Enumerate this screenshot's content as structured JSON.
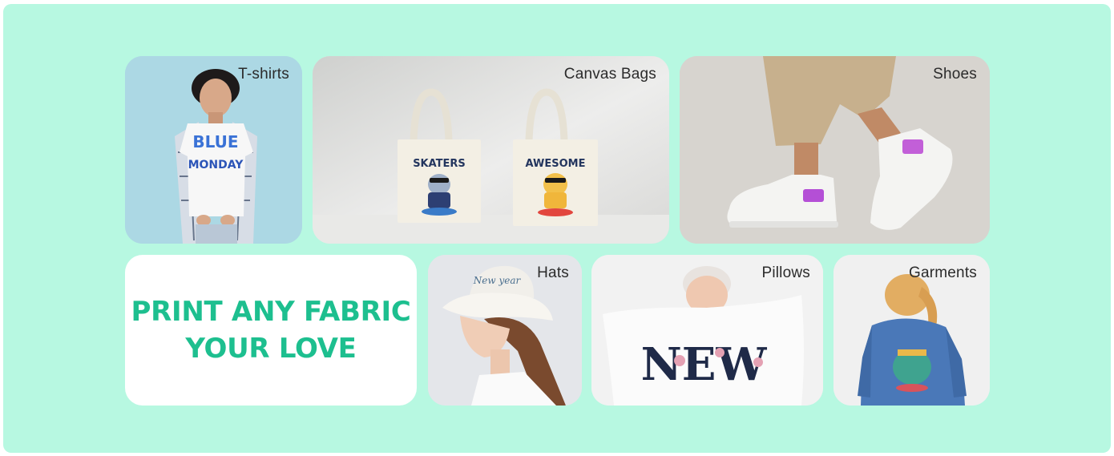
{
  "colors": {
    "banner_background": "#b7f8e1",
    "headline_text": "#1dbf8f",
    "label_text": "#2b2b2b"
  },
  "tiles": {
    "tshirts": {
      "label": "T-shirts",
      "print_lines": [
        "BLUE",
        "MONDAY"
      ]
    },
    "canvas_bags": {
      "label": "Canvas Bags",
      "bag_prints": [
        "SKATERS",
        "AWESOME"
      ]
    },
    "shoes": {
      "label": "Shoes"
    },
    "hats": {
      "label": "Hats",
      "hat_print": "New year"
    },
    "pillows": {
      "label": "Pillows",
      "pillow_print": "NEW"
    },
    "garments": {
      "label": "Garments"
    }
  },
  "headline": {
    "line1": "PRINT ANY FABRIC",
    "line2": "YOUR LOVE"
  }
}
